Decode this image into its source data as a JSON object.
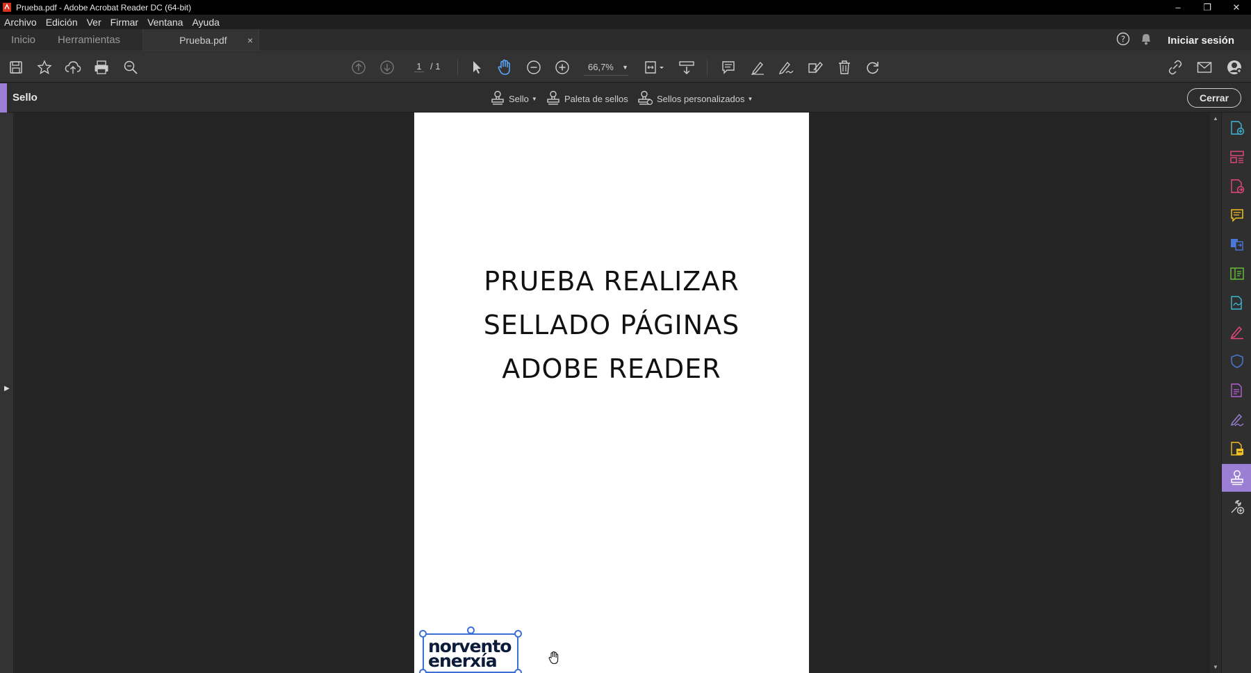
{
  "window": {
    "title": "Prueba.pdf - Adobe Acrobat Reader DC (64-bit)"
  },
  "menu": [
    "Archivo",
    "Edición",
    "Ver",
    "Firmar",
    "Ventana",
    "Ayuda"
  ],
  "tabs": {
    "home": "Inicio",
    "tools": "Herramientas",
    "document": "Prueba.pdf",
    "close": "×"
  },
  "account": {
    "signin": "Iniciar sesión"
  },
  "toolbar": {
    "page_current": "1",
    "page_total": "/ 1",
    "zoom": "66,7%"
  },
  "stamp_tools": {
    "title": "Sello",
    "stamp": "Sello",
    "palette": "Paleta de sellos",
    "custom": "Sellos personalizados",
    "close": "Cerrar"
  },
  "document": {
    "lines": [
      "PRUEBA REALIZAR",
      "SELLADO PÁGINAS",
      "ADOBE READER"
    ],
    "stamp_logo": [
      "norvento",
      "enerxía"
    ]
  },
  "colors": {
    "accent": "#9b7fd4",
    "selection": "#3a6fd6",
    "page": "#ffffff",
    "canvas": "#242424"
  }
}
